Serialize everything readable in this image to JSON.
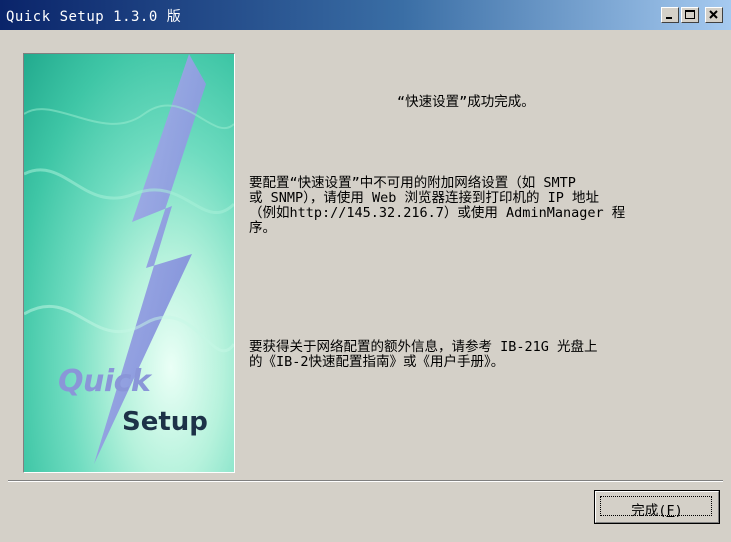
{
  "window": {
    "title": "Quick Setup 1.3.0 版"
  },
  "banner": {
    "logo_line1": "Quick",
    "logo_line2": "Setup",
    "icon": "lightning-bolt"
  },
  "content": {
    "heading": "“快速设置”成功完成。",
    "paragraph1": "要配置“快速设置”中不可用的附加网络设置（如 SMTP\n或 SNMP），请使用 Web 浏览器连接到打印机的 IP 地址\n（例如http://145.32.216.7）或使用 AdminManager 程\n序。",
    "paragraph2": "要获得关于网络配置的额外信息，请参考 IB-21G 光盘上\n的《IB-2快速配置指南》或《用户手册》。"
  },
  "footer": {
    "finish_label": "完成",
    "finish_key_open": "(",
    "finish_key": "F",
    "finish_key_close": ")"
  },
  "colors": {
    "titlebar_start": "#0a246a",
    "titlebar_end": "#a6caf0",
    "dialog_bg": "#d4d0c8",
    "banner_teal": "#3fc6a6",
    "bolt": "#8a96d8"
  }
}
